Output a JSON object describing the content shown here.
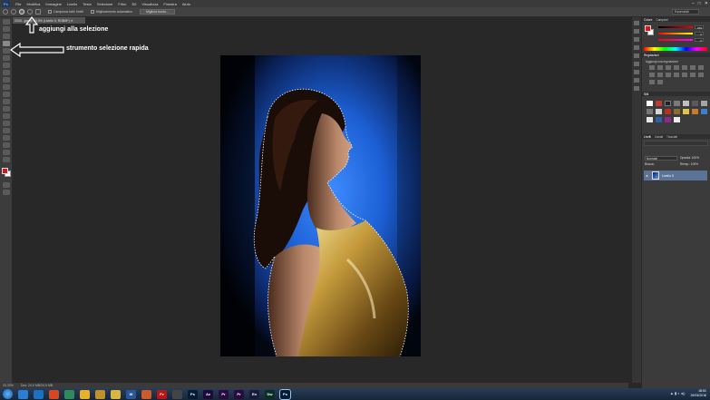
{
  "app": {
    "logo": "Ps",
    "menu": [
      "File",
      "Modifica",
      "Immagine",
      "Livello",
      "Testo",
      "Selezione",
      "Filtro",
      "3D",
      "Visualizza",
      "Finestra",
      "Aiuto"
    ],
    "window_controls": [
      "–",
      "□",
      "✕"
    ]
  },
  "options_bar": {
    "check_all_layers": "Campiona tutti i livelli",
    "check_auto_enhance": "Miglioramento automatico",
    "refine_button": "Migliora bordo...",
    "workspace": "Essenziali"
  },
  "document": {
    "tab_label": "2040...jpg @ 33,3% (Livello 0, RGB/8*)  ✕",
    "zoom": "33,33%",
    "doc_info": "Doc: 24,9 MB/24,9 MB"
  },
  "annotations": {
    "add_to_selection": "aggiungi alla selezione",
    "quick_selection_tool": "strumento selezione rapida"
  },
  "panels": {
    "color_tabs": [
      "Colore",
      "Campioni"
    ],
    "rgb_values": [
      "255",
      "0",
      "0"
    ],
    "adjust_tabs": [
      "Regolazioni"
    ],
    "adjust_title": "Aggiungi una regolazione",
    "style_tabs": [
      "Stili"
    ],
    "layers_tabs": [
      "Livelli",
      "Canali",
      "Tracciati"
    ],
    "blend_mode": "Normale",
    "opacity_label": "Opacità: 100%",
    "lock_label": "Blocca:",
    "fill_label": "Riemp.: 100%",
    "layer_name": "Livello 0",
    "eye": "●"
  },
  "taskbar": {
    "apps": [
      {
        "label": "",
        "color": "#2a7fd4"
      },
      {
        "label": "",
        "color": "#1d6fc2"
      },
      {
        "label": "",
        "color": "#d9461f"
      },
      {
        "label": "",
        "color": "#2e8b57"
      },
      {
        "label": "",
        "color": "#e8b02c"
      },
      {
        "label": "",
        "color": "#c2902a"
      },
      {
        "label": "",
        "color": "#d8b640"
      },
      {
        "label": "W",
        "color": "#2b5797"
      },
      {
        "label": "",
        "color": "#cc5a2a"
      },
      {
        "label": "Fz",
        "color": "#b5171b"
      },
      {
        "label": "",
        "color": "#444"
      },
      {
        "label": "Ps",
        "color": "#001d34"
      },
      {
        "label": "Ae",
        "color": "#1d0a3a"
      },
      {
        "label": "Pr",
        "color": "#2a0a3f"
      },
      {
        "label": "Pr",
        "color": "#2a0a3f"
      },
      {
        "label": "En",
        "color": "#1a1a3a"
      },
      {
        "label": "Dw",
        "color": "#072f24"
      },
      {
        "label": "Ps",
        "color": "#001d34",
        "active": true
      }
    ],
    "tray": "▲ ▮ ◐ ◂))",
    "time": "18:51",
    "date": "29/03/2016"
  }
}
